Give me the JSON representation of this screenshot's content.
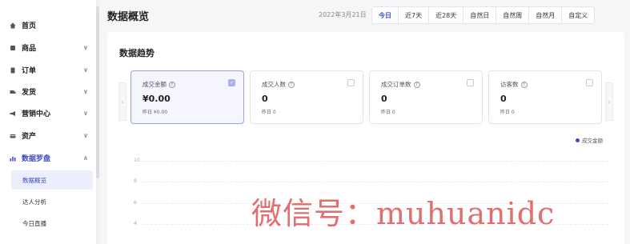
{
  "sidebar": {
    "items": [
      {
        "label": "首页",
        "icon": "home-icon",
        "expandable": false
      },
      {
        "label": "商品",
        "icon": "goods-icon",
        "expandable": true,
        "chevron": "∨"
      },
      {
        "label": "订单",
        "icon": "order-icon",
        "expandable": true,
        "chevron": "∨"
      },
      {
        "label": "发货",
        "icon": "truck-icon",
        "expandable": true,
        "chevron": "∨"
      },
      {
        "label": "营销中心",
        "icon": "megaphone-icon",
        "expandable": true,
        "chevron": "∨"
      },
      {
        "label": "资产",
        "icon": "wallet-icon",
        "expandable": true,
        "chevron": "∨"
      },
      {
        "label": "数据罗盘",
        "icon": "chart-icon",
        "expandable": true,
        "chevron": "∧",
        "active": true
      }
    ],
    "sub_items": [
      {
        "label": "数据概览",
        "active": true
      },
      {
        "label": "达人分析",
        "active": false
      },
      {
        "label": "今日直播",
        "active": false
      }
    ]
  },
  "header": {
    "title": "数据概览",
    "date": "2022年3月21日",
    "tabs": [
      "今日",
      "近7天",
      "近28天",
      "自然日",
      "自然周",
      "自然月",
      "自定义"
    ],
    "active_tab": "今日"
  },
  "trend": {
    "title": "数据趋势",
    "prev_arrow": "‹",
    "next_arrow": "›",
    "cards": [
      {
        "title": "成交金额",
        "value": "¥0.00",
        "yesterday": "昨日 ¥0.00",
        "selected": true
      },
      {
        "title": "成交人数",
        "value": "0",
        "yesterday": "昨日 0",
        "selected": false
      },
      {
        "title": "成交订单数",
        "value": "0",
        "yesterday": "昨日 0",
        "selected": false
      },
      {
        "title": "访客数",
        "value": "0",
        "yesterday": "昨日 0",
        "selected": false
      }
    ],
    "help_mark": "?",
    "check_mark": "✓",
    "legend": "成交金额",
    "y_ticks": [
      "10",
      "8",
      "6",
      "4"
    ]
  },
  "watermark": "微信号：muhuanidc",
  "colors": {
    "accent": "#3c48c9",
    "watermark": "#da4646"
  }
}
